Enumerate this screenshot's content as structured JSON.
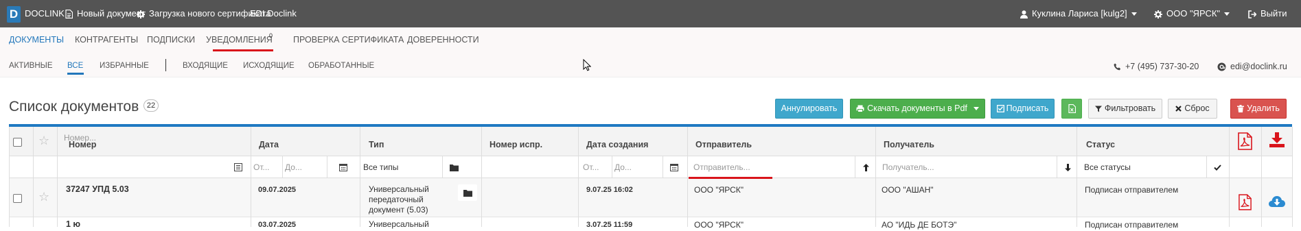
{
  "topbar": {
    "logo_letter": "D",
    "brand": "DOCLINK",
    "new_doc": "Новый документ",
    "upload_cert": "Загрузка нового сертификата",
    "edi": "EDI.Doclink",
    "user": "Куклина Лариса [kulg2]",
    "org": "ООО \"ЯРСК\"",
    "logout": "Выйти"
  },
  "nav1": {
    "documents": "Документы",
    "contragents": "Контрагенты",
    "signatures": "Подписки",
    "notifications": "Уведомления",
    "notifications_count": "0",
    "cert_check": "Проверка сертификата",
    "trust": "Доверенности"
  },
  "nav2": {
    "active": "Активные",
    "all": "Все",
    "favorites": "Избранные",
    "incoming": "Входящие",
    "outgoing": "Исходящие",
    "processed": "Обработанные",
    "phone": "+7 (495) 737-30-20",
    "email": "edi@doclink.ru"
  },
  "list": {
    "title": "Список документов",
    "count": "22"
  },
  "toolbar": {
    "annul": "Аннулировать",
    "download_pdf": "Скачать документы в Pdf",
    "sign": "Подписать",
    "filter": "Фильтровать",
    "reset": "Сброс",
    "delete": "Удалить"
  },
  "columns": {
    "number": "Номер",
    "date": "Дата",
    "type": "Тип",
    "fix_number": "Номер испр.",
    "created": "Дата создания",
    "sender": "Отправитель",
    "recipient": "Получатель",
    "status": "Статус"
  },
  "filters": {
    "number_ph": "Номер...",
    "from": "От...",
    "to": "До...",
    "types": "Все типы",
    "created_from": "От...",
    "created_to": "До...",
    "sender_ph": "Отправитель...",
    "recipient_ph": "Получатель...",
    "statuses": "Все статусы"
  },
  "rows": [
    {
      "number": "37247 УПД 5.03",
      "date": "09.07.2025",
      "type_line1": "Универсальный",
      "type_line2": "передаточный",
      "type_line3": "документ (5.03)",
      "created": "9.07.25 16:02",
      "sender": "ООО \"ЯРСК\"",
      "recipient": "ООО \"АШАН\"",
      "status": "Подписан отправителем"
    },
    {
      "number": "1 ю",
      "date": "03.07.2025",
      "type_line1": "Универсальный",
      "created": "3.07.25 11:59",
      "sender": "ООО \"ЯРСК\"",
      "recipient": "АО \"ИДЬ ДЕ БОТЭ\"",
      "status": "Подписан отправителем"
    }
  ],
  "colors": {
    "topbar": "#545454",
    "accent_blue": "#1f79c2",
    "accent_red": "#d9141b"
  }
}
